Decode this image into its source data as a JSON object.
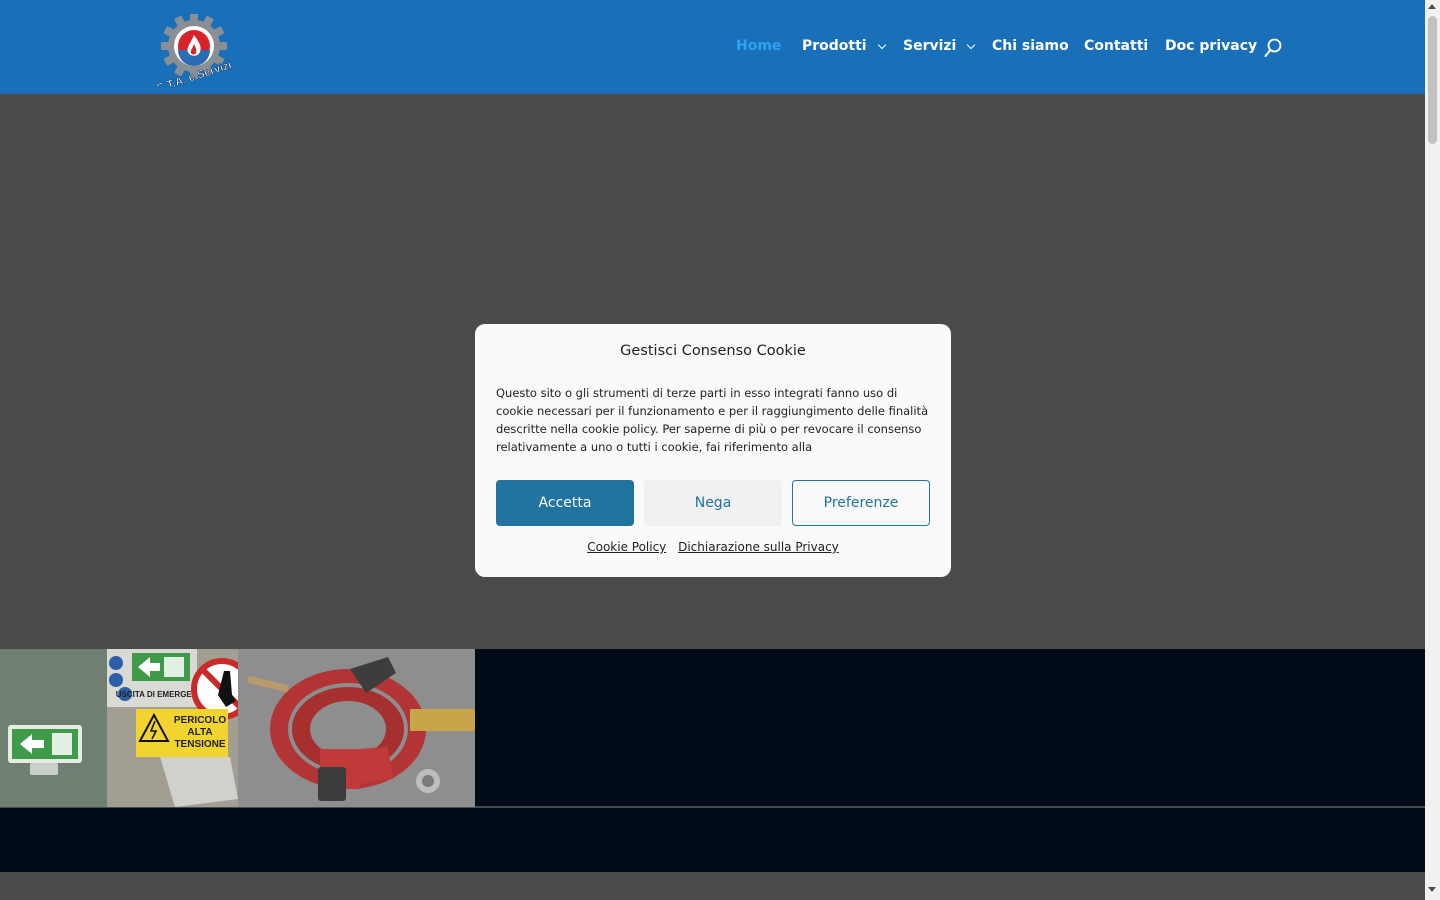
{
  "header": {
    "logo_text": "S.T.A. e Servizi",
    "nav": [
      {
        "label": "Home",
        "active": true,
        "has_dropdown": false
      },
      {
        "label": "Prodotti",
        "active": false,
        "has_dropdown": true
      },
      {
        "label": "Servizi",
        "active": false,
        "has_dropdown": true
      },
      {
        "label": "Chi siamo",
        "active": false,
        "has_dropdown": false
      },
      {
        "label": "Contatti",
        "active": false,
        "has_dropdown": false
      },
      {
        "label": "Doc privacy",
        "active": false,
        "has_dropdown": false
      }
    ],
    "search_icon": "search-icon"
  },
  "colors": {
    "header_bg": "#1a70b8",
    "nav_active": "#2ea3f2",
    "accent_button": "#21749f"
  },
  "strip": {
    "sign_texts": [
      "USCITA DI EMERGENZA",
      "PERICOLO",
      "ALTA TENSIONE"
    ]
  },
  "cookie_modal": {
    "title": "Gestisci Consenso Cookie",
    "body": "Questo sito o gli strumenti di terze parti in esso integrati fanno uso di cookie necessari per il funzionamento e per il raggiungimento delle finalità descritte nella cookie policy. Per saperne di più o per revocare il consenso relativamente a uno o tutti i cookie, fai riferimento alla",
    "accept_label": "Accetta",
    "deny_label": "Nega",
    "preferences_label": "Preferenze",
    "links": [
      "Cookie Policy",
      "Dichiarazione sulla Privacy"
    ]
  }
}
